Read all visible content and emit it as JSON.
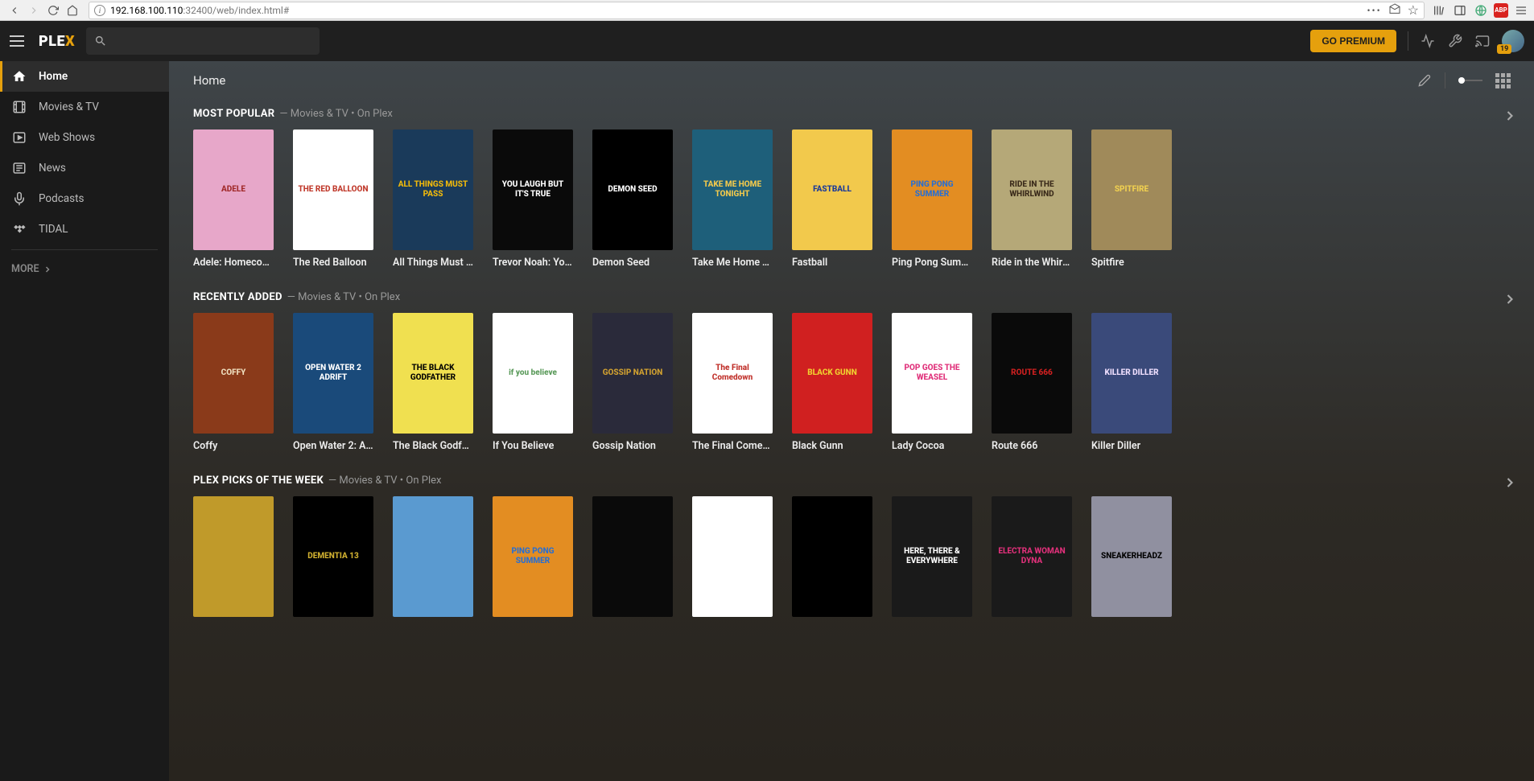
{
  "browser": {
    "url_host": "192.168.100.110",
    "url_rest": ":32400/web/index.html#",
    "abp": "ABP"
  },
  "header": {
    "logo_a": "PLE",
    "logo_b": "X",
    "premium": "GO PREMIUM",
    "badge_count": "19"
  },
  "sidebar": {
    "items": [
      {
        "label": "Home"
      },
      {
        "label": "Movies & TV"
      },
      {
        "label": "Web Shows"
      },
      {
        "label": "News"
      },
      {
        "label": "Podcasts"
      },
      {
        "label": "TIDAL"
      }
    ],
    "more": "MORE"
  },
  "page": {
    "title": "Home"
  },
  "sections": [
    {
      "title": "MOST POPULAR",
      "subtitle": "— Movies & TV • On Plex",
      "items": [
        {
          "title": "Adele: Homecoming",
          "art": "ADELE",
          "bg": "#e7a7c9",
          "fg": "#a12a2a"
        },
        {
          "title": "The Red Balloon",
          "art": "THE RED BALLOON",
          "bg": "#ffffff",
          "fg": "#c0392b"
        },
        {
          "title": "All Things Must Pa...",
          "art": "ALL THINGS MUST PASS",
          "bg": "#1a3a5a",
          "fg": "#f0b90b"
        },
        {
          "title": "Trevor Noah: You ...",
          "art": "YOU LAUGH BUT IT'S TRUE",
          "bg": "#0a0a0a",
          "fg": "#ffffff"
        },
        {
          "title": "Demon Seed",
          "art": "DEMON SEED",
          "bg": "#000000",
          "fg": "#ffffff"
        },
        {
          "title": "Take Me Home To...",
          "art": "TAKE ME HOME TONIGHT",
          "bg": "#1e5f7a",
          "fg": "#f2c94c"
        },
        {
          "title": "Fastball",
          "art": "FASTBALL",
          "bg": "#f2c94c",
          "fg": "#1a3a9a"
        },
        {
          "title": "Ping Pong Summer",
          "art": "PING PONG SUMMER",
          "bg": "#e38d22",
          "fg": "#2a6fd0"
        },
        {
          "title": "Ride in the Whirlw...",
          "art": "RIDE IN THE WHIRLWIND",
          "bg": "#b5a878",
          "fg": "#3a2a1a"
        },
        {
          "title": "Spitfire",
          "art": "SPITFIRE",
          "bg": "#a08a5a",
          "fg": "#f0d050"
        }
      ]
    },
    {
      "title": "RECENTLY ADDED",
      "subtitle": "— Movies & TV • On Plex",
      "items": [
        {
          "title": "Coffy",
          "art": "COFFY",
          "bg": "#8a3a1a",
          "fg": "#f0e0c0"
        },
        {
          "title": "Open Water 2: Ad...",
          "art": "OPEN WATER 2 ADRIFT",
          "bg": "#1a4a7a",
          "fg": "#ffffff"
        },
        {
          "title": "The Black Godfath...",
          "art": "THE BLACK GODFATHER",
          "bg": "#f0e050",
          "fg": "#000000"
        },
        {
          "title": "If You Believe",
          "art": "if you believe",
          "bg": "#ffffff",
          "fg": "#5a9a5a"
        },
        {
          "title": "Gossip Nation",
          "art": "GOSSIP NATION",
          "bg": "#2a2a3a",
          "fg": "#d0a030"
        },
        {
          "title": "The Final Comedo...",
          "art": "The Final Comedown",
          "bg": "#ffffff",
          "fg": "#c0302a"
        },
        {
          "title": "Black Gunn",
          "art": "BLACK GUNN",
          "bg": "#d02020",
          "fg": "#f0d030"
        },
        {
          "title": "Lady Cocoa",
          "art": "POP GOES THE WEASEL",
          "bg": "#ffffff",
          "fg": "#e0307a"
        },
        {
          "title": "Route 666",
          "art": "ROUTE 666",
          "bg": "#0a0a0a",
          "fg": "#d02020"
        },
        {
          "title": "Killer Diller",
          "art": "KILLER DILLER",
          "bg": "#3a4a7a",
          "fg": "#f0e0ff"
        }
      ]
    },
    {
      "title": "PLEX PICKS OF THE WEEK",
      "subtitle": "— Movies & TV • On Plex",
      "items": [
        {
          "title": "",
          "art": "",
          "bg": "#c09a2a",
          "fg": "#000"
        },
        {
          "title": "",
          "art": "DEMENTIA 13",
          "bg": "#000000",
          "fg": "#d0b030"
        },
        {
          "title": "",
          "art": "",
          "bg": "#5a9ad0",
          "fg": "#fff"
        },
        {
          "title": "",
          "art": "PING PONG SUMMER",
          "bg": "#e38d22",
          "fg": "#2a6fd0"
        },
        {
          "title": "",
          "art": "",
          "bg": "#0a0a0a",
          "fg": "#fff"
        },
        {
          "title": "",
          "art": "",
          "bg": "#ffffff",
          "fg": "#000"
        },
        {
          "title": "",
          "art": "",
          "bg": "#000000",
          "fg": "#fff"
        },
        {
          "title": "",
          "art": "HERE, THERE & EVERYWHERE",
          "bg": "#1a1a1a",
          "fg": "#fff"
        },
        {
          "title": "",
          "art": "ELECTRA WOMAN DYNA",
          "bg": "#1a1a1a",
          "fg": "#e0307a"
        },
        {
          "title": "",
          "art": "SNEAKERHEADZ",
          "bg": "#9090a0",
          "fg": "#000"
        }
      ]
    }
  ]
}
